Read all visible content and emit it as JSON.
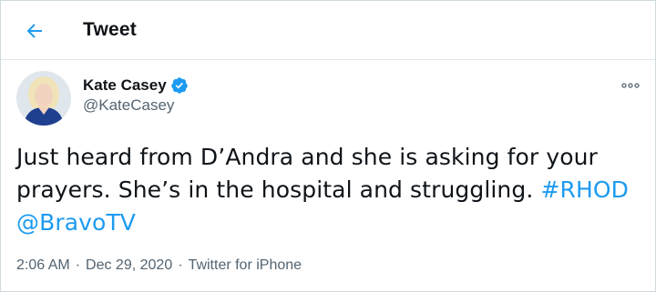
{
  "header": {
    "title": "Tweet",
    "back_icon": "arrow-left-icon"
  },
  "author": {
    "display_name": "Kate Casey",
    "handle": "@KateCasey",
    "verified": true,
    "verified_icon": "verified-badge-icon"
  },
  "tweet": {
    "text_part1": "Just heard from D’Andra and she is asking for your prayers. She’s in the hospital and struggling. ",
    "hashtag": "#RHOD",
    "mention": "@BravoTV"
  },
  "meta": {
    "time": "2:06 AM",
    "separator1": "·",
    "date": "Dec 29, 2020",
    "separator2": "·",
    "source": "Twitter for iPhone"
  },
  "colors": {
    "accent": "#1d9bf0",
    "text": "#0f1419",
    "secondary": "#536471"
  }
}
